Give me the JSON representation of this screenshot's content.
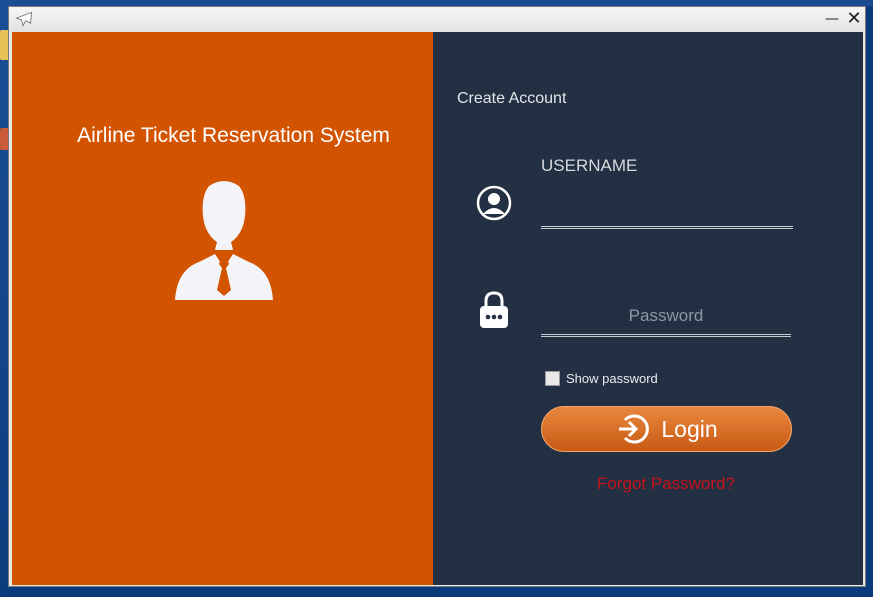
{
  "window": {
    "minimize_glyph": "—",
    "close_glyph": "✕"
  },
  "left_panel": {
    "title": "Airline Ticket Reservation System",
    "background_color": "#d35400"
  },
  "right_panel": {
    "create_account_link": "Create Account",
    "username_label": "USERNAME",
    "username_value": "",
    "password_placeholder": "Password",
    "show_password_label": "Show password",
    "show_password_checked": false,
    "login_button_label": "Login",
    "forgot_password_link": "Forgot Password?",
    "background_color": "#232f42",
    "link_color": "#c4121b"
  },
  "icons": {
    "app": "airplane-icon",
    "avatar": "businessman-avatar-icon",
    "user": "user-circle-icon",
    "lock": "padlock-icon",
    "login": "sign-in-arrow-icon"
  }
}
